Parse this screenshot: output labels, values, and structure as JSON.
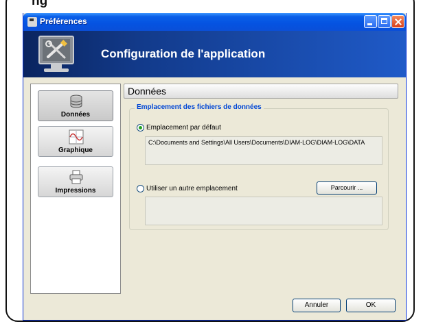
{
  "background_caption": "ng",
  "window": {
    "title": "Préférences",
    "title_icon": "settings-app-icon",
    "controls": [
      "minimize",
      "maximize",
      "close"
    ]
  },
  "banner": {
    "heading": "Configuration de l'application",
    "icon": "tools-monitor-icon"
  },
  "sidebar": {
    "items": [
      {
        "label": "Données",
        "icon": "database-icon",
        "active": true
      },
      {
        "label": "Graphique",
        "icon": "chart-icon",
        "active": false
      },
      {
        "label": "Impressions",
        "icon": "printer-icon",
        "active": false
      }
    ]
  },
  "panel": {
    "title": "Données",
    "group_title": "Emplacement des fichiers de données",
    "default_option": {
      "label": "Emplacement par défaut",
      "checked": true,
      "path": "C:\\Documents and Settings\\All Users\\Documents\\DIAM-LOG\\DIAM-LOG\\DATA"
    },
    "other_option": {
      "label": "Utiliser un autre emplacement",
      "checked": false,
      "path": "",
      "browse_label": "Parcourir ..."
    }
  },
  "footer": {
    "cancel_label": "Annuler",
    "ok_label": "OK"
  },
  "colors": {
    "titlebar": "#0553e1",
    "banner": "#123a8a",
    "group_title": "#0046d5",
    "dialog_bg": "#ece9d8"
  }
}
